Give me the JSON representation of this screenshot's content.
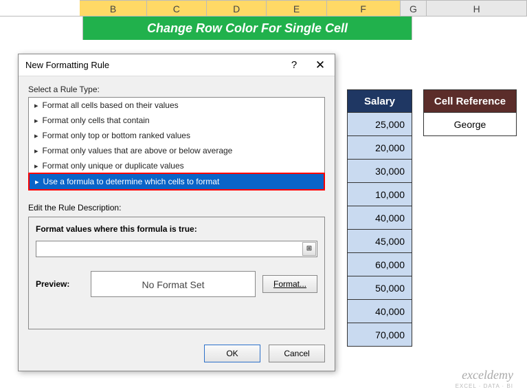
{
  "columns": {
    "b": "B",
    "c": "C",
    "d": "D",
    "e": "E",
    "f": "F",
    "g": "G",
    "h": "H"
  },
  "sheet_title": "Change Row Color For Single Cell",
  "salary": {
    "header": "Salary",
    "rows": [
      "25,000",
      "20,000",
      "30,000",
      "10,000",
      "40,000",
      "45,000",
      "60,000",
      "50,000",
      "40,000",
      "70,000"
    ]
  },
  "reference": {
    "header": "Cell Reference",
    "value": "George"
  },
  "dialog": {
    "title": "New Formatting Rule",
    "help": "?",
    "close": "✕",
    "select_label": "Select a Rule Type:",
    "rules": [
      "Format all cells based on their values",
      "Format only cells that contain",
      "Format only top or bottom ranked values",
      "Format only values that are above or below average",
      "Format only unique or duplicate values",
      "Use a formula to determine which cells to format"
    ],
    "edit_label": "Edit the Rule Description:",
    "formula_label": "Format values where this formula is true:",
    "formula_value": "",
    "preview_label": "Preview:",
    "preview_text": "No Format Set",
    "format_btn": "Format...",
    "ok": "OK",
    "cancel": "Cancel"
  },
  "watermark": "exceldemy",
  "watermark_sub": "EXCEL · DATA · BI"
}
